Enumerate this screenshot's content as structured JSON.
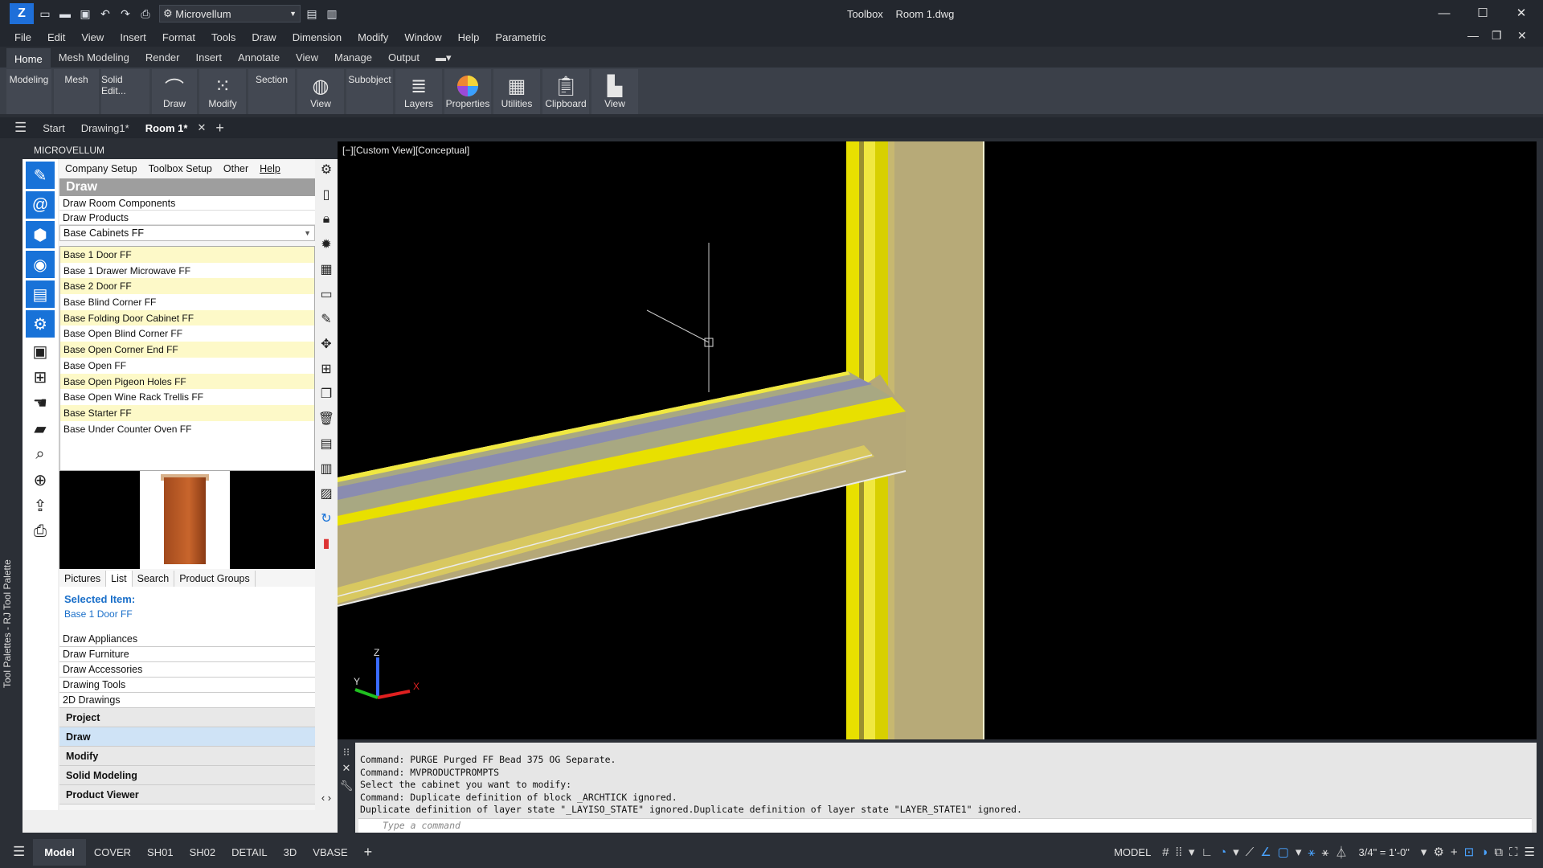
{
  "titlebar": {
    "workspace": "Microvellum",
    "title_app": "Toolbox",
    "title_doc": "Room 1.dwg",
    "minimize": "—",
    "maximize": "☐",
    "close": "✕"
  },
  "menubar": [
    "File",
    "Edit",
    "View",
    "Insert",
    "Format",
    "Tools",
    "Draw",
    "Dimension",
    "Modify",
    "Window",
    "Help",
    "Parametric"
  ],
  "ribbon_tabs": [
    "Home",
    "Mesh Modeling",
    "Render",
    "Insert",
    "Annotate",
    "View",
    "Manage",
    "Output"
  ],
  "ribbon_buttons": [
    {
      "label": "Modeling",
      "icon": ""
    },
    {
      "label": "Mesh",
      "icon": ""
    },
    {
      "label": "Solid Edit...",
      "icon": ""
    },
    {
      "label": "Draw",
      "icon": "arc-icon"
    },
    {
      "label": "Modify",
      "icon": "modify-icon"
    },
    {
      "label": "Section",
      "icon": ""
    },
    {
      "label": "View",
      "icon": "globe-icon"
    },
    {
      "label": "Subobject",
      "icon": ""
    },
    {
      "label": "Layers",
      "icon": "layers-icon"
    },
    {
      "label": "Properties",
      "icon": "color-wheel-icon"
    },
    {
      "label": "Utilities",
      "icon": "calculator-icon"
    },
    {
      "label": "Clipboard",
      "icon": "clipboard-icon"
    },
    {
      "label": "View",
      "icon": "view-icon"
    }
  ],
  "doc_tabs": [
    "Start",
    "Drawing1*",
    "Room 1*"
  ],
  "palette_label": "Tool Palettes - RJ Tool Palette",
  "mv": {
    "header": "MICROVELLUM",
    "menu": [
      "Company Setup",
      "Toolbox Setup",
      "Other",
      "Help"
    ],
    "draw_title": "Draw",
    "draw_room_components": "Draw Room Components",
    "draw_products": "Draw Products",
    "category": "Base Cabinets FF",
    "items": [
      "Base 1 Door FF",
      "Base 1 Drawer Microwave FF",
      "Base 2 Door FF",
      "Base Blind Corner FF",
      "Base Folding Door Cabinet FF",
      "Base Open Blind Corner FF",
      "Base Open Corner End FF",
      "Base Open FF",
      "Base Open Pigeon Holes FF",
      "Base Open Wine Rack Trellis FF",
      "Base Starter FF",
      "Base Under Counter Oven FF"
    ],
    "subtabs": [
      "Pictures",
      "List",
      "Search",
      "Product Groups"
    ],
    "selected_label": "Selected Item:",
    "selected_value": "Base 1 Door FF",
    "groups": [
      "Draw Appliances",
      "Draw Furniture",
      "Draw Accessories",
      "Drawing Tools",
      "2D Drawings"
    ],
    "nav": [
      "Project",
      "Draw",
      "Modify",
      "Solid Modeling",
      "Product Viewer"
    ]
  },
  "viewport": {
    "label": "[−][Custom View][Conceptual]",
    "axis_x": "X",
    "axis_y": "Y",
    "axis_z": "Z"
  },
  "command": {
    "lines": [
      "Command: PURGE Purged FF Bead 375 OG Separate.",
      "Command: MVPRODUCTPROMPTS",
      "Select the cabinet you want to modify:",
      "Command: Duplicate definition of block _ARCHTICK  ignored.",
      "Duplicate definition of layer state \"_LAYISO_STATE\" ignored.Duplicate definition of layer state \"LAYER_STATE1\" ignored."
    ],
    "placeholder": "Type a command"
  },
  "statusbar": {
    "tabs": [
      "Model",
      "COVER",
      "SH01",
      "SH02",
      "DETAIL",
      "3D",
      "VBASE"
    ],
    "model_label": "MODEL",
    "scale": "3/4\" = 1'-0\""
  },
  "colors": {
    "accent_blue": "#1872d8",
    "item_highlight": "#fdf9c8",
    "yellow_edge": "#f0f000",
    "tan_face": "#b7aa78"
  }
}
